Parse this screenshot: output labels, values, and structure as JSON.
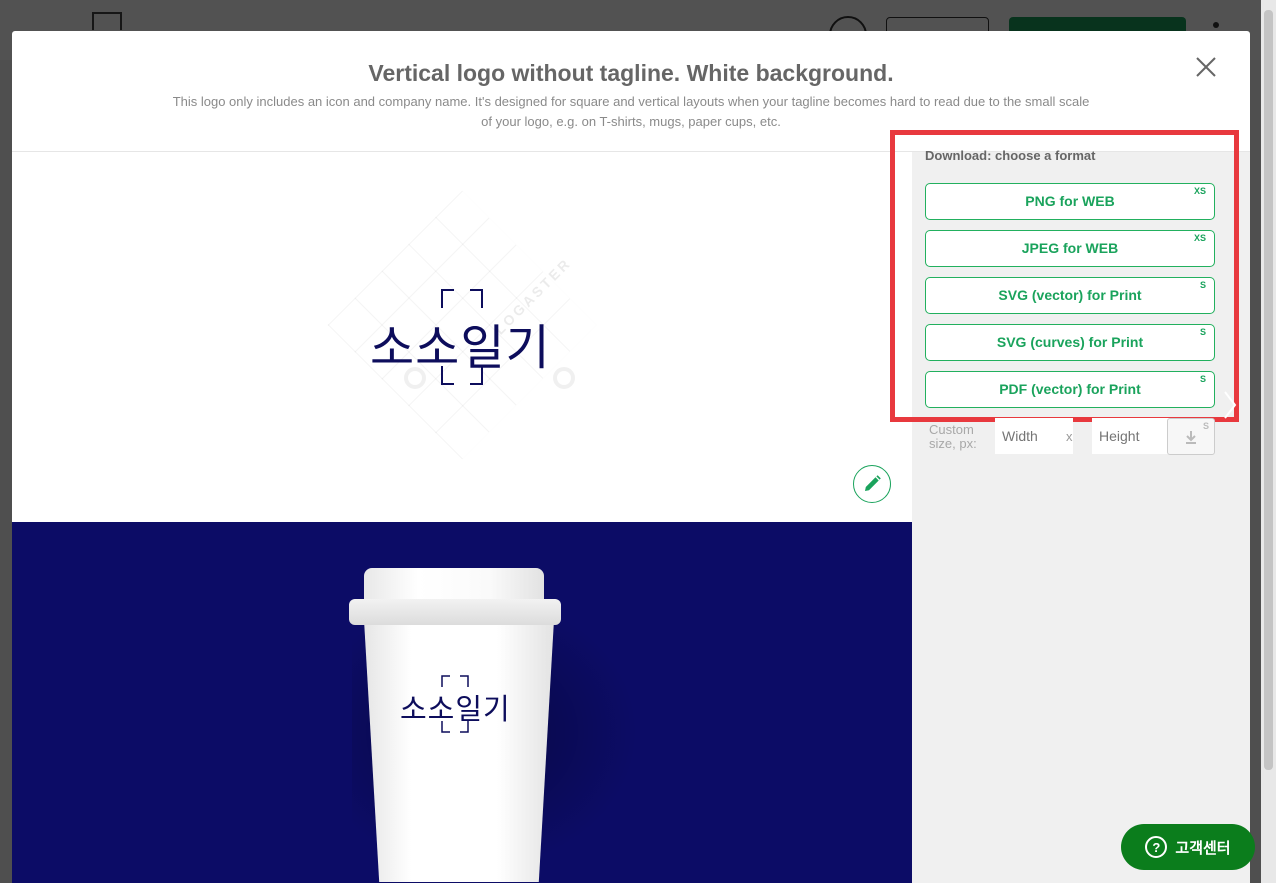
{
  "modal": {
    "title": "Vertical logo without tagline. White background.",
    "description": "This logo only includes an icon and company name. It's designed for square and vertical layouts when your tagline becomes hard to read due to the small scale of your logo, e.g. on T-shirts, mugs, paper cups, etc."
  },
  "preview": {
    "logo_name": "소소일기",
    "watermark": "LOGASTER"
  },
  "download": {
    "title": "Download: choose a format",
    "formats": [
      {
        "label": "PNG for WEB",
        "size": "XS"
      },
      {
        "label": "JPEG for WEB",
        "size": "XS"
      },
      {
        "label": "SVG (vector) for Print",
        "size": "S"
      },
      {
        "label": "SVG (curves) for Print",
        "size": "S"
      },
      {
        "label": "PDF (vector) for Print",
        "size": "S"
      }
    ],
    "custom_size_label": "Custom size, px:",
    "width_placeholder": "Width",
    "height_placeholder": "Height",
    "separator": "x",
    "custom_download_size": "S"
  },
  "help": {
    "label": "고객센터",
    "icon": "?"
  },
  "colors": {
    "accent_green": "#1aa35c",
    "highlight_red": "#e8393e",
    "navy": "#0c0c66",
    "help_green": "#0b7d1c"
  }
}
